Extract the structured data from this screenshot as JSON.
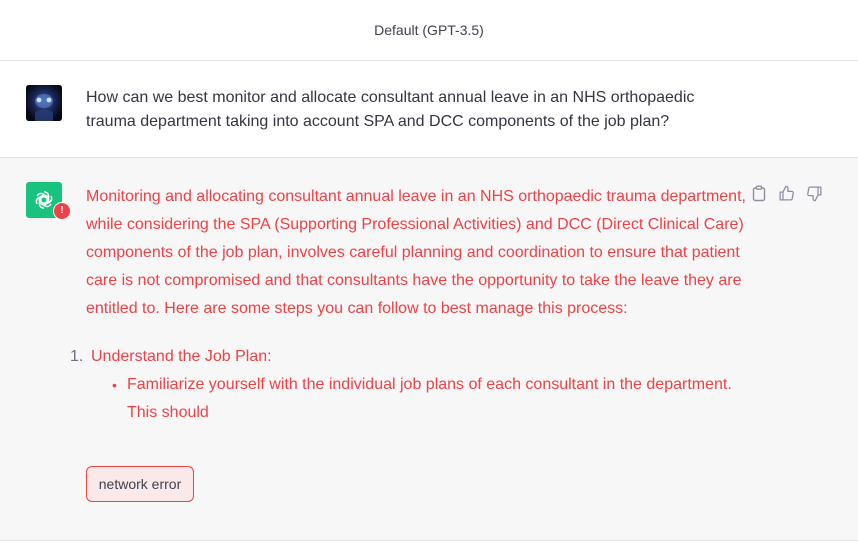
{
  "header": {
    "model_label": "Default (GPT-3.5)"
  },
  "user_message": {
    "text": "How can we best monitor and allocate consultant annual leave in an NHS orthopaedic trauma department taking into account SPA and DCC components of the job plan?"
  },
  "assistant_message": {
    "intro": "Monitoring and allocating consultant annual leave in an NHS orthopaedic trauma department, while considering the SPA (Supporting Professional Activities) and DCC (Direct Clinical Care) components of the job plan, involves careful planning and coordination to ensure that patient care is not compromised and that consultants have the opportunity to take the leave they are entitled to. Here are some steps you can follow to best manage this process:",
    "list": [
      {
        "number": "1.",
        "title": "Understand the Job Plan:",
        "bullets": [
          "Familiarize yourself with the individual job plans of each consultant in the department. This should"
        ]
      }
    ],
    "error_label": "network error",
    "error_badge": "!"
  },
  "colors": {
    "error": "#ef4146",
    "brand_green": "#19c37d",
    "assistant_bg": "#f7f7f8"
  },
  "icons": [
    "copy-icon",
    "thumbs-up-icon",
    "thumbs-down-icon",
    "openai-logo-icon"
  ]
}
